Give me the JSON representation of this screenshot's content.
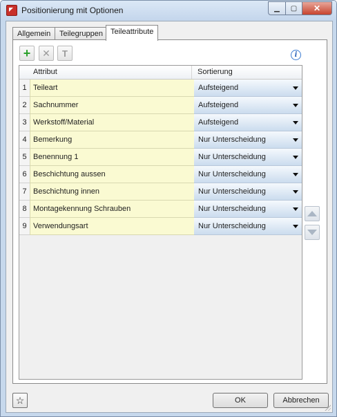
{
  "window": {
    "title": "Positionierung mit Optionen",
    "icon": "hicad-app-icon",
    "controls": [
      "minimize-icon",
      "maximize-icon",
      "close-icon"
    ]
  },
  "tabs": [
    {
      "label": "Allgemein",
      "active": false
    },
    {
      "label": "Teilegruppen",
      "active": false
    },
    {
      "label": "Teileattribute",
      "active": true
    }
  ],
  "toolbar": {
    "icons": [
      "add-icon",
      "delete-icon",
      "rename-icon"
    ],
    "info_icon_glyph": "i"
  },
  "table": {
    "columns": [
      "Attribut",
      "Sortierung"
    ],
    "rows": [
      {
        "n": "1",
        "attribute": "Teileart",
        "sorting": "Aufsteigend"
      },
      {
        "n": "2",
        "attribute": "Sachnummer",
        "sorting": "Aufsteigend"
      },
      {
        "n": "3",
        "attribute": "Werkstoff/Material",
        "sorting": "Aufsteigend"
      },
      {
        "n": "4",
        "attribute": "Bemerkung",
        "sorting": "Nur Unterscheidung"
      },
      {
        "n": "5",
        "attribute": "Benennung 1",
        "sorting": "Nur Unterscheidung"
      },
      {
        "n": "6",
        "attribute": "Beschichtung aussen",
        "sorting": "Nur Unterscheidung"
      },
      {
        "n": "7",
        "attribute": "Beschichtung innen",
        "sorting": "Nur Unterscheidung"
      },
      {
        "n": "8",
        "attribute": "Montagekennung Schrauben",
        "sorting": "Nur Unterscheidung"
      },
      {
        "n": "9",
        "attribute": "Verwendungsart",
        "sorting": "Nur Unterscheidung"
      }
    ]
  },
  "side_buttons": [
    "move-up-icon",
    "move-down-icon"
  ],
  "footer": {
    "ok_label": "OK",
    "cancel_label": "Abbrechen",
    "star_glyph": "☆"
  },
  "colors": {
    "attribute_cell_bg": "#fafad2",
    "title_bar": "#c4d6ec",
    "close_button": "#c7432e"
  }
}
